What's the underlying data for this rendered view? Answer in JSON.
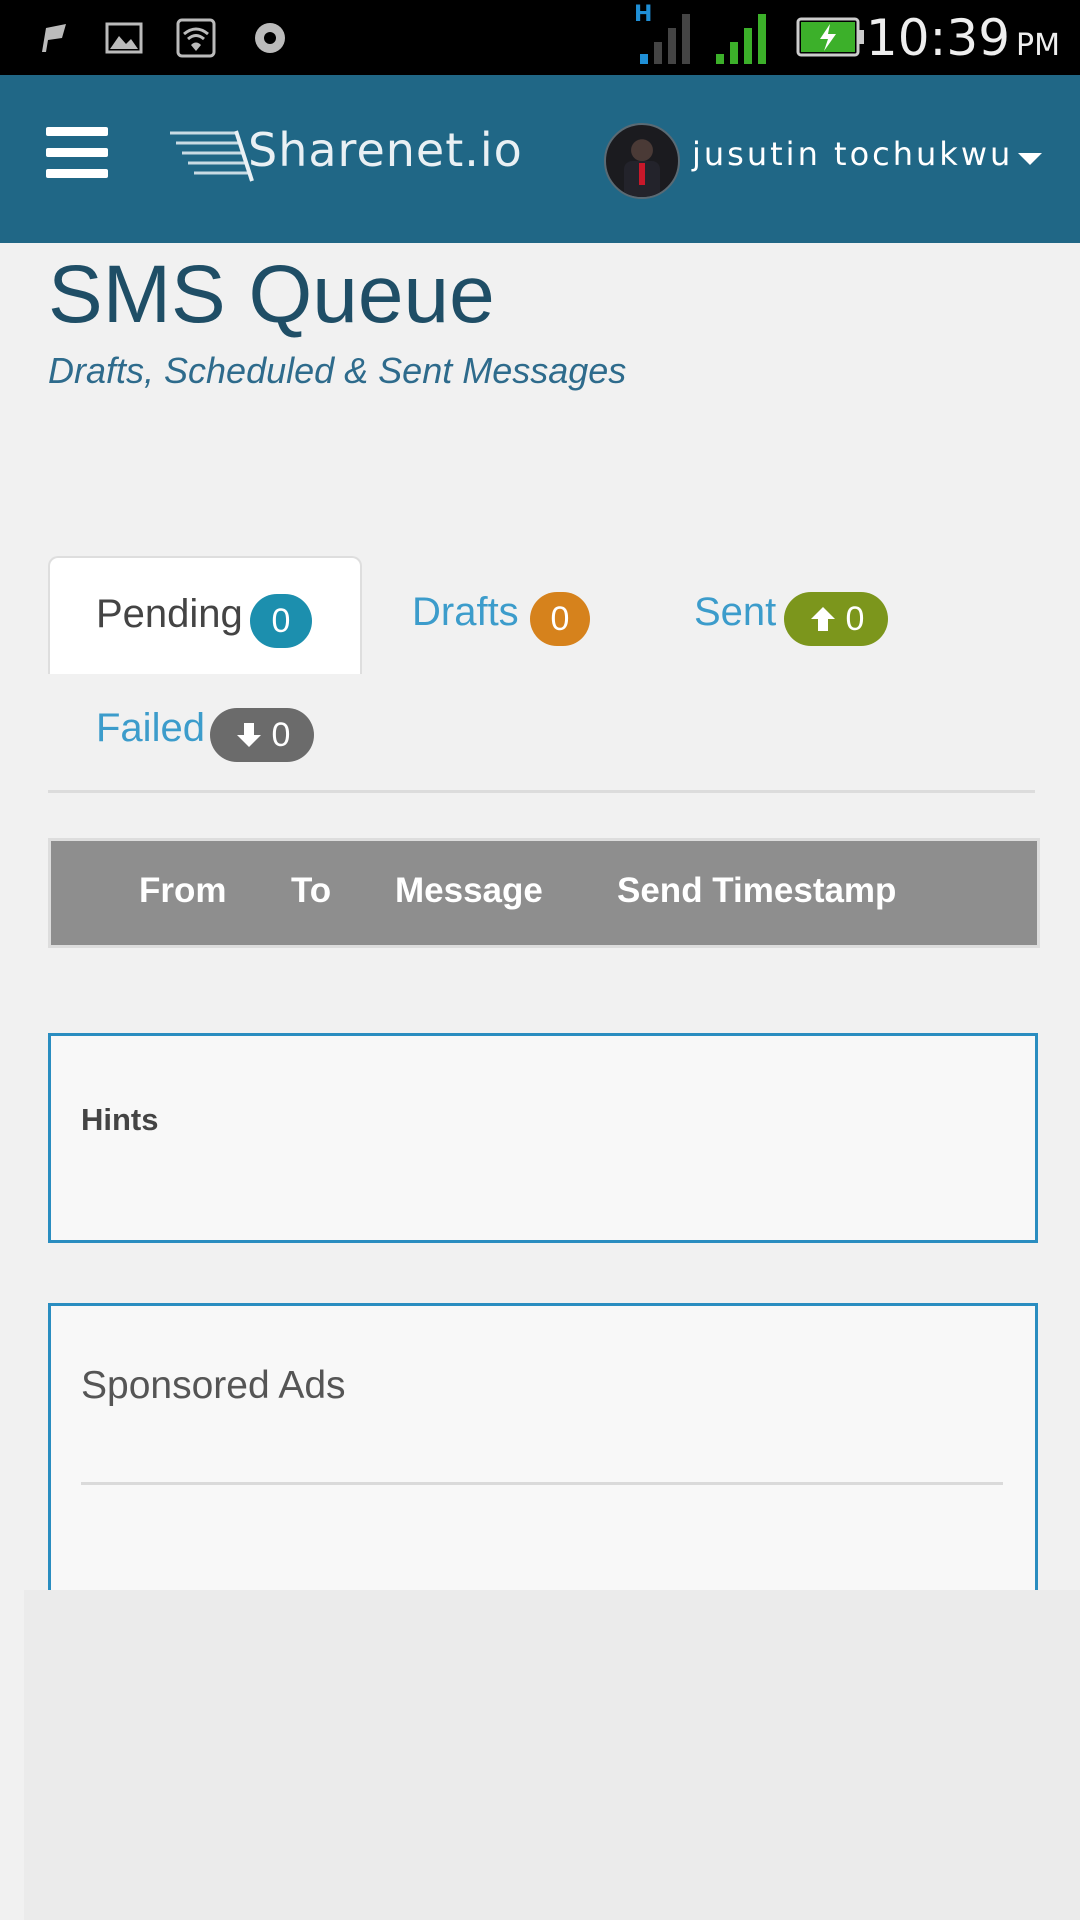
{
  "status_bar": {
    "network_type": "H",
    "time": "10:39",
    "ampm": "PM",
    "icons": [
      "notification-flag-icon",
      "image-icon",
      "wifi-icon",
      "record-icon",
      "signal-icon",
      "signal-icon",
      "battery-charging-icon"
    ]
  },
  "header": {
    "logo_text": "Sharenet.io",
    "username": "jusutin tochukwu"
  },
  "page": {
    "title": "SMS Queue",
    "subtitle": "Drafts, Scheduled & Sent Messages"
  },
  "tabs": [
    {
      "label": "Pending",
      "count": "0",
      "badge_color": "#1c8fae",
      "active": true
    },
    {
      "label": "Drafts",
      "count": "0",
      "badge_color": "#d6821c",
      "active": false
    },
    {
      "label": "Sent",
      "count": "0",
      "badge_color": "#7c961c",
      "icon": "arrow-up-icon",
      "active": false
    },
    {
      "label": "Failed",
      "count": "0",
      "badge_color": "#6b6b6b",
      "icon": "arrow-down-icon",
      "active": false
    }
  ],
  "table": {
    "columns": [
      "From",
      "To",
      "Message",
      "Send Timestamp"
    ]
  },
  "hints": {
    "title": "Hints"
  },
  "ads": {
    "title": "Sponsored Ads"
  },
  "colors": {
    "header_bg": "#206786",
    "tab_link": "#3c9ccb",
    "panel_border": "#2a8dc0",
    "table_head_bg": "#8e8e8e"
  }
}
